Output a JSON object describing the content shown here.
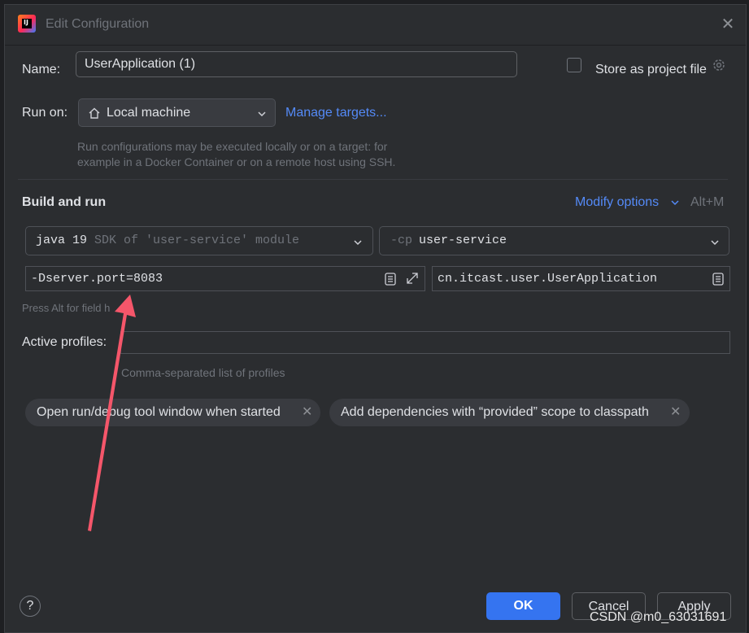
{
  "window": {
    "title": "Edit Configuration"
  },
  "name_row": {
    "label": "Name:",
    "value": "UserApplication (1)",
    "store_label": "Store as project file"
  },
  "run_on": {
    "label": "Run on:",
    "value": "Local machine",
    "manage_link": "Manage targets...",
    "hint_line1": "Run configurations may be executed locally or on a target: for",
    "hint_line2": "example in a Docker Container or on a remote host using SSH."
  },
  "build_and_run": {
    "heading": "Build and run",
    "modify_options": "Modify options",
    "shortcut": "Alt+M",
    "sdk_name": "java 19",
    "sdk_detail": "SDK of 'user-service' module",
    "cp_flag": "-cp",
    "cp_value": "user-service",
    "vm_options": "-Dserver.port=8083",
    "main_class": "cn.itcast.user.UserApplication",
    "field_hint": "Press Alt for field h"
  },
  "profiles": {
    "label": "Active profiles:",
    "value": "",
    "hint": "Comma-separated list of profiles"
  },
  "chips": [
    {
      "label": "Open run/debug tool window when started"
    },
    {
      "label": "Add dependencies with “provided” scope to classpath"
    }
  ],
  "footer": {
    "help": "?",
    "ok": "OK",
    "cancel": "Cancel",
    "apply": "Apply"
  },
  "watermark": "CSDN @m0_63031691",
  "colors": {
    "accent": "#548af7",
    "ok_button": "#3574f0",
    "arrow": "#f5566a"
  }
}
